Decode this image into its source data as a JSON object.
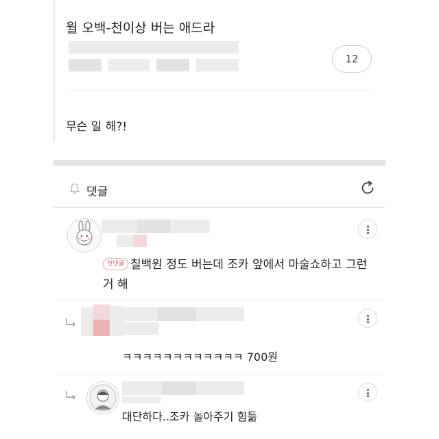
{
  "post": {
    "title": "월 오백-천이상 버는 애드라",
    "reply_count": "12",
    "body": "무슨 일 해?!"
  },
  "comments_section": {
    "title": "댓글"
  },
  "comments": [
    {
      "badge": "첫댓글",
      "text_line1": "칠백원 정도 버는데 조카 앞에서 마술쇼하고 그런",
      "text_line2": "거 해"
    },
    {
      "text": "ㅋㅋㅋㅋㅋㅋㅋㅋㅋㅋㅋㅋ 700원"
    },
    {
      "text": "대단하다..조카 놀아주기 힘듦"
    }
  ],
  "colors": {
    "divider": "#e4e4e4",
    "badge": "#d06060",
    "text": "#222222"
  },
  "icons": [
    "bell-icon",
    "refresh-icon",
    "more-icon",
    "reply-arrow-icon",
    "avatar-icon"
  ]
}
